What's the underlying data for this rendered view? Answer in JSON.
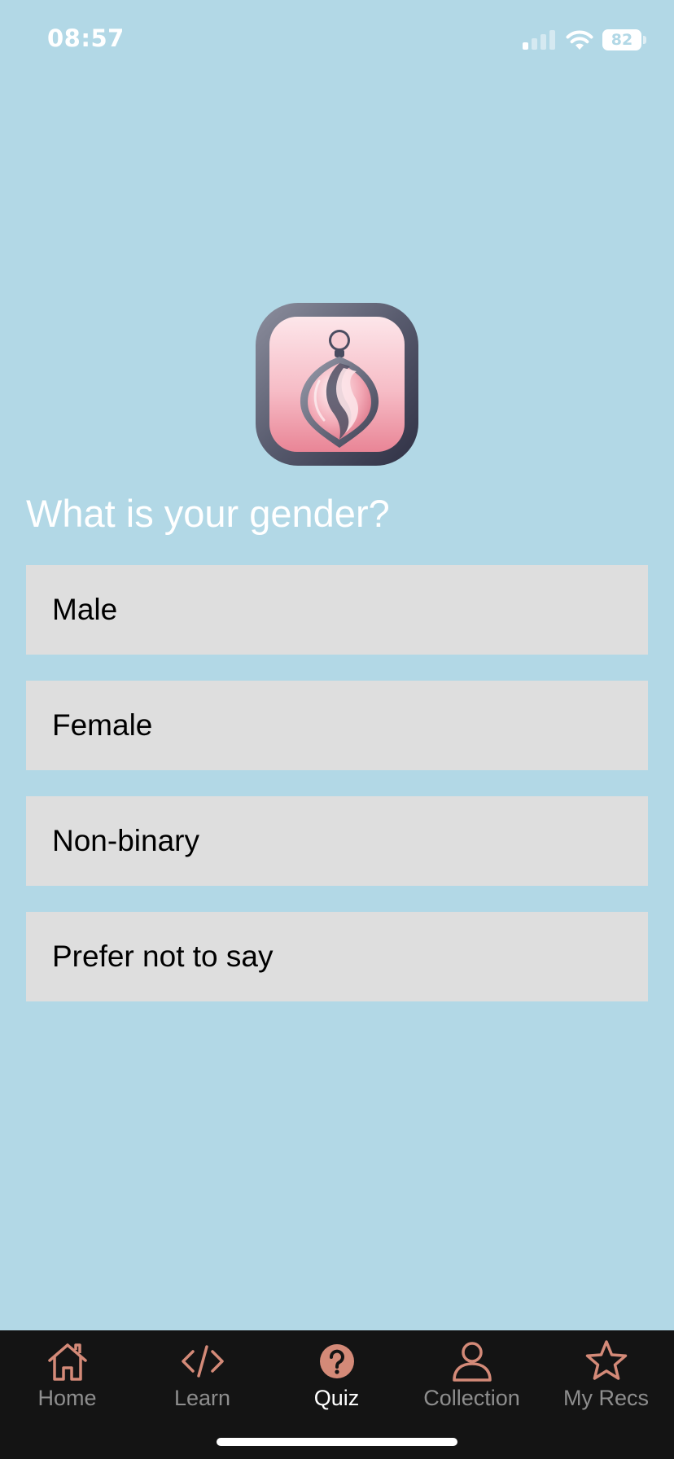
{
  "status_bar": {
    "time": "08:57",
    "battery": "82",
    "signal_icon": "cellular-signal-icon",
    "wifi_icon": "wifi-icon",
    "battery_icon": "battery-icon"
  },
  "logo": {
    "icon": "perfume-bottle-icon"
  },
  "quiz": {
    "question": "What is your gender?",
    "options": [
      "Male",
      "Female",
      "Non-binary",
      "Prefer not to say"
    ]
  },
  "tabbar": {
    "tabs": [
      {
        "label": "Home",
        "icon": "home-icon"
      },
      {
        "label": "Learn",
        "icon": "code-icon"
      },
      {
        "label": "Quiz",
        "icon": "question-circle-icon"
      },
      {
        "label": "Collection",
        "icon": "person-icon"
      },
      {
        "label": "My Recs",
        "icon": "star-icon"
      }
    ],
    "active": "Quiz"
  },
  "colors": {
    "background": "#b2d8e6",
    "option_background": "#dedede",
    "tabbar_background": "#141414",
    "icon_accent": "#d48a78",
    "inactive_label": "#8e8e8e",
    "active_label": "#ffffff"
  }
}
